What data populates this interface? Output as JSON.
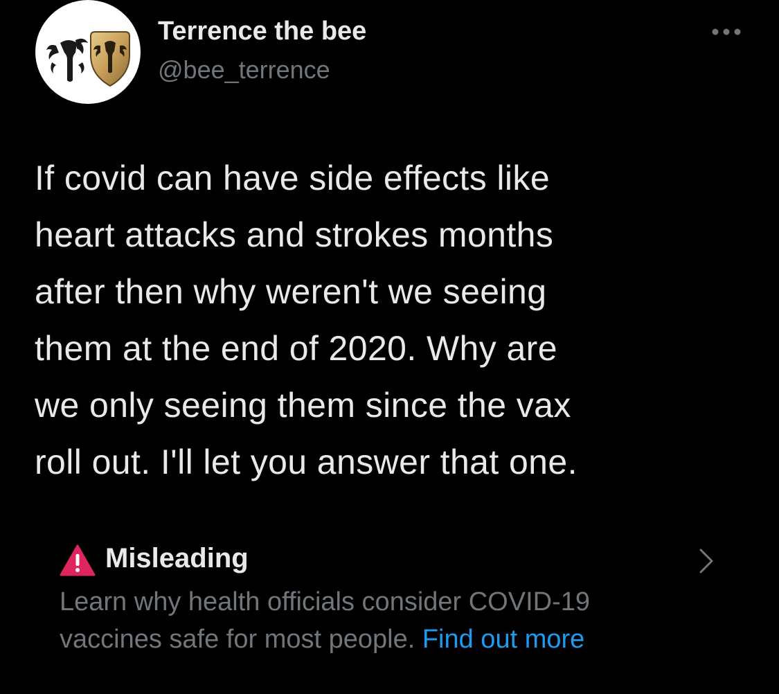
{
  "user": {
    "display_name": "Terrence the bee",
    "handle": "@bee_terrence",
    "avatar_icon": "mandalorian-emblem-avatar"
  },
  "menu": {
    "icon": "more-horizontal-icon"
  },
  "tweet": {
    "lines": [
      "If covid can have side effects like",
      "heart attacks and strokes months",
      "after then why weren't we seeing",
      "them at the end of 2020. Why are",
      "we only seeing them since the vax",
      "roll out. I'll let you answer that one."
    ]
  },
  "notice": {
    "icon": "warning-triangle-icon",
    "title": "Misleading",
    "body_lines": [
      "Learn why health officials consider COVID-19",
      "vaccines safe for most people."
    ],
    "link_text": "Find out more",
    "chevron_icon": "chevron-right-icon"
  },
  "colors": {
    "background": "#000000",
    "primary_text": "#e7e9ea",
    "secondary_text": "#71767b",
    "link": "#1d9bf0",
    "warning": "#e0245e"
  }
}
